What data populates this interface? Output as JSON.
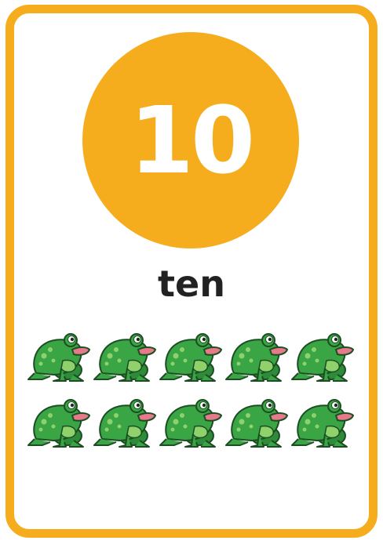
{
  "card": {
    "numeral": "10",
    "word": "ten",
    "border_color": "#f6ad1d",
    "circle_color": "#f6ad1d"
  },
  "counters": {
    "icon": "frog-icon",
    "count": 10,
    "rows": 2,
    "per_row": 5
  }
}
